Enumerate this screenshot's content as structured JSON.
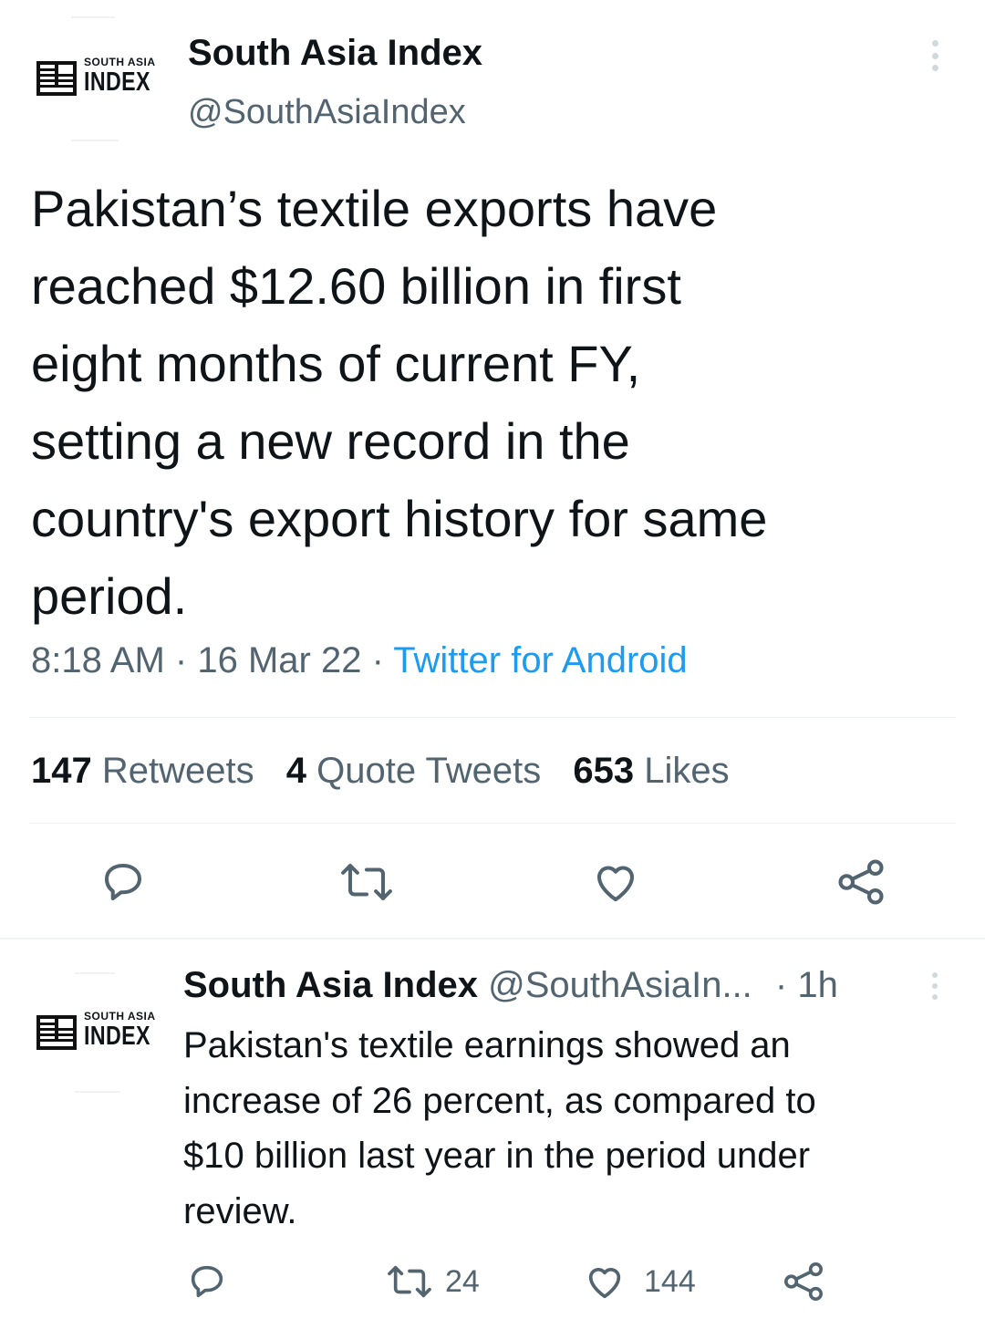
{
  "main_tweet": {
    "author_name": "South Asia Index",
    "handle": "@SouthAsiaIndex",
    "logo": {
      "line1": "SOUTH ASIA",
      "line2": "INDEX"
    },
    "text_lines": [
      "Pakistan’s textile exports have",
      "reached $12.60 billion in first",
      "eight months of current FY,",
      "setting a new record in the",
      "country's export history for same",
      "period."
    ],
    "time": "8:18 AM",
    "date": "16 Mar 22",
    "sep": "·",
    "source": "Twitter for Android",
    "stats": {
      "retweets_count": "147",
      "retweets_label": "Retweets",
      "quotes_count": "4",
      "quotes_label": "Quote Tweets",
      "likes_count": "653",
      "likes_label": "Likes"
    },
    "actions": [
      "reply-icon",
      "retweet-icon",
      "like-icon",
      "share-icon"
    ]
  },
  "reply_tweet": {
    "author_name": "South Asia Index",
    "handle": "@SouthAsiaIn...",
    "sep": "·",
    "time": "1h",
    "logo": {
      "line1": "SOUTH ASIA",
      "line2": "INDEX"
    },
    "text_lines": [
      "Pakistan's textile earnings showed an",
      "increase of 26 percent, as compared to",
      "$10 billion last year in the period under",
      "review."
    ],
    "retweets": "24",
    "likes": "144"
  },
  "colors": {
    "text": "#0f1419",
    "muted": "#536471",
    "link": "#1d9bf0",
    "divider": "#eff3f4"
  }
}
